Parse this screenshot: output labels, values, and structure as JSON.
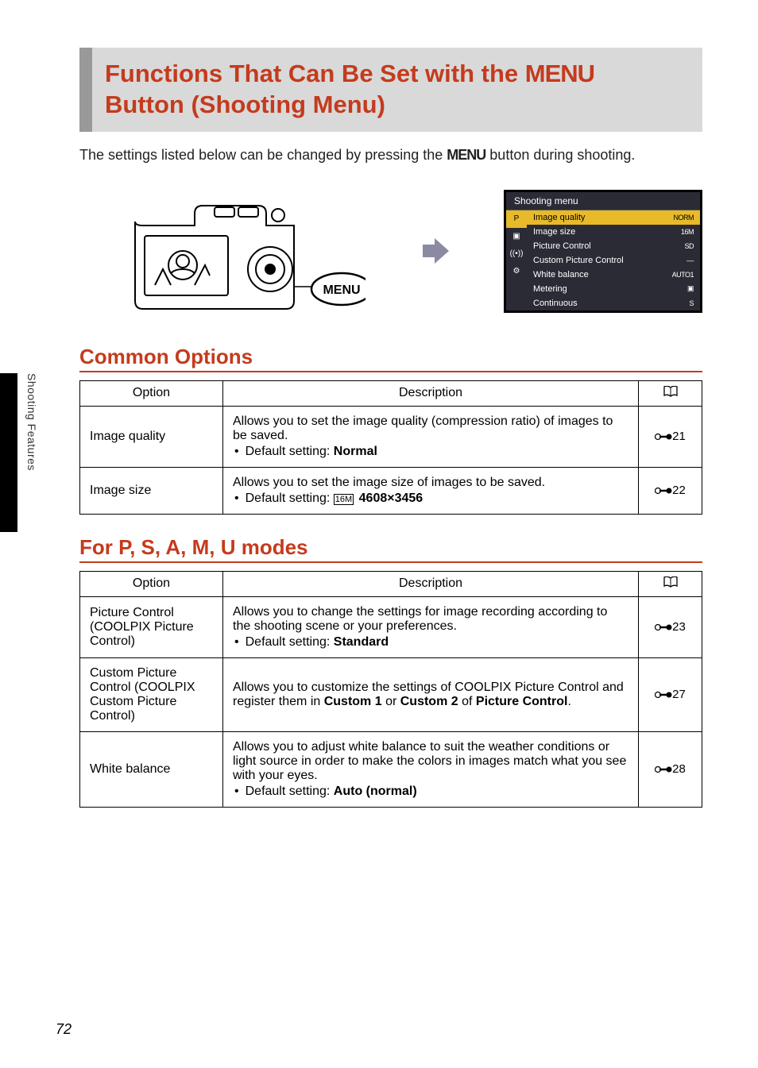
{
  "title_line1": "Functions That Can Be Set with the",
  "title_menu": "MENU",
  "title_line2": "Button (Shooting Menu)",
  "intro_a": "The settings listed below can be changed by pressing the ",
  "intro_menu": "MENU",
  "intro_b": " button during shooting.",
  "menu_button_label": "MENU",
  "lcd": {
    "header": "Shooting menu",
    "tabs": [
      "P",
      "▣",
      "((•))",
      "⚙"
    ],
    "items": [
      {
        "label": "Image quality",
        "val": "NORM",
        "hl": true
      },
      {
        "label": "Image size",
        "val": "16M"
      },
      {
        "label": "Picture Control",
        "val": "SD"
      },
      {
        "label": "Custom Picture Control",
        "val": "––"
      },
      {
        "label": "White balance",
        "val": "AUTO1"
      },
      {
        "label": "Metering",
        "val": "▣"
      },
      {
        "label": "Continuous",
        "val": "S"
      }
    ]
  },
  "h2_common": "Common Options",
  "h2_for": "For ",
  "h2_modes_letters": "P, S, A, M, U",
  "h2_modes_suffix": " modes",
  "headers": {
    "option": "Option",
    "description": "Description"
  },
  "common_rows": [
    {
      "option": "Image quality",
      "desc": "Allows you to set the image quality (compression ratio) of images to be saved.",
      "default_prefix": "Default setting: ",
      "default_bold": "Normal",
      "ref": "21"
    },
    {
      "option": "Image size",
      "desc": "Allows you to set the image size of images to be saved.",
      "default_prefix": "Default setting: ",
      "default_icon": "16M",
      "default_bold": "4608×3456",
      "ref": "22"
    }
  ],
  "mode_rows": [
    {
      "option": "Picture Control (COOLPIX Picture Control)",
      "desc": "Allows you to change the settings for image recording according to the shooting scene or your preferences.",
      "default_prefix": "Default setting: ",
      "default_bold": "Standard",
      "ref": "23"
    },
    {
      "option": "Custom Picture Control (COOLPIX Custom Picture Control)",
      "desc_a": "Allows you to customize the settings of COOLPIX Picture Control and register them in ",
      "desc_bold1": "Custom 1",
      "desc_b": " or ",
      "desc_bold2": "Custom 2",
      "desc_c": " of ",
      "desc_bold3": "Picture Control",
      "desc_d": ".",
      "ref": "27"
    },
    {
      "option": "White balance",
      "desc": "Allows you to adjust white balance to suit the weather conditions or light source in order to make the colors in images match what you see with your eyes.",
      "default_prefix": "Default setting: ",
      "default_bold": "Auto (normal)",
      "ref": "28"
    }
  ],
  "side_label": "Shooting Features",
  "page_number": "72"
}
